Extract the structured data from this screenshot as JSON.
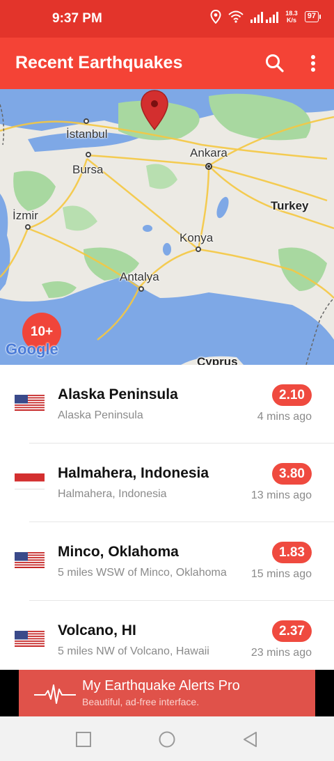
{
  "status_bar": {
    "time": "9:37 PM",
    "net_speed_value": "18.3",
    "net_speed_unit": "K/s",
    "battery": "97"
  },
  "app_bar": {
    "title": "Recent Earthquakes",
    "search_icon": "search-icon",
    "more_icon": "more-vert-icon"
  },
  "map": {
    "cities": {
      "istanbul": "İstanbul",
      "bursa": "Bursa",
      "izmir": "İzmir",
      "ankara": "Ankara",
      "konya": "Konya",
      "antalya": "Antalya",
      "turkey": "Turkey",
      "cyprus": "Cyprus"
    },
    "cluster_label": "10+",
    "attribution": "Google",
    "pin_color": "#d32f2f"
  },
  "earthquakes": [
    {
      "flag": "us",
      "title": "Alaska Peninsula",
      "subtitle": "Alaska Peninsula",
      "magnitude": "2.10",
      "time_ago": "4 mins ago"
    },
    {
      "flag": "id",
      "title": "Halmahera, Indonesia",
      "subtitle": "Halmahera, Indonesia",
      "magnitude": "3.80",
      "time_ago": "13 mins ago"
    },
    {
      "flag": "us",
      "title": "Minco, Oklahoma",
      "subtitle": "5 miles WSW of Minco, Oklahoma",
      "magnitude": "1.83",
      "time_ago": "15 mins ago"
    },
    {
      "flag": "us",
      "title": "Volcano, HI",
      "subtitle": "5 miles NW of Volcano, Hawaii",
      "magnitude": "2.37",
      "time_ago": "23 mins ago"
    }
  ],
  "ad": {
    "title": "My Earthquake Alerts Pro",
    "subtitle": "Beautiful, ad-free interface."
  },
  "colors": {
    "status_bar": "#e3342b",
    "app_bar": "#f44336",
    "magnitude_badge": "#ef4a3f",
    "ad_background": "#e0524a"
  }
}
